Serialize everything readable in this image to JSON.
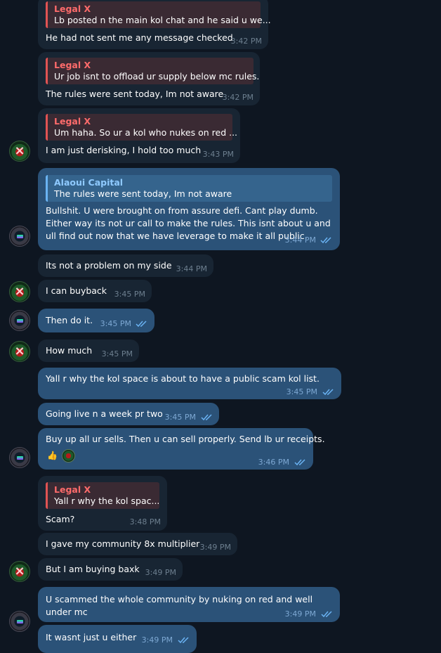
{
  "messages": {
    "m1": {
      "quote_name": "Legal X",
      "quote_text": "Lb posted n the main kol chat and he said u we...",
      "text": "He had not sent me any message checked",
      "time": "3:42 PM"
    },
    "m2": {
      "quote_name": "Legal X",
      "quote_text": "Ur job isnt to offload ur supply below mc rules.",
      "text": "The rules were sent today, Im not aware",
      "time": "3:42 PM"
    },
    "m3": {
      "quote_name": "Legal X",
      "quote_text": "Um haha. So ur a kol who nukes on red ...",
      "text": "I am just derisking, I hold too much",
      "time": "3:43 PM"
    },
    "m4": {
      "quote_name": "Alaoui Capital",
      "quote_text": "The rules were sent today, Im not aware",
      "text": "Bullshit. U were brought on from assure defi. Cant play dumb. Either way its not ur call to make the rules. This isnt about u and ull find out now that we have leverage to make it all public.",
      "time": "3:44 PM"
    },
    "m5": {
      "text": "Its not a problem on my side",
      "time": "3:44 PM"
    },
    "m6": {
      "text": "I can buyback",
      "time": "3:45 PM"
    },
    "m7": {
      "text": "Then do it.",
      "time": "3:45 PM"
    },
    "m8": {
      "text": "How much",
      "time": "3:45 PM"
    },
    "m9": {
      "text": "Yall r why the kol space is about to have a public scam kol list.",
      "time": "3:45 PM"
    },
    "m10": {
      "text": "Going live n a week pr two",
      "time": "3:45 PM"
    },
    "m11": {
      "text": "Buy up all ur sells. Then u can sell properly. Send lb ur receipts.",
      "time": "3:46 PM",
      "reactions": [
        "thumbs-up",
        "avatar"
      ]
    },
    "m12": {
      "quote_name": "Legal X",
      "quote_text": "Yall r why the kol spac...",
      "text": "Scam?",
      "time": "3:48 PM"
    },
    "m13": {
      "text": "I gave my community 8x multiplier",
      "time": "3:49 PM"
    },
    "m14": {
      "text": "But I am buying baxk",
      "time": "3:49 PM"
    },
    "m15": {
      "text": "U scammed the whole community by nuking on red and well under mc",
      "time": "3:49 PM"
    },
    "m16": {
      "text": "It wasnt just u either",
      "time": "3:49 PM"
    }
  },
  "colors": {
    "background": "#0e1621",
    "incoming_bubble": "#182533",
    "outgoing_bubble": "#2b5278",
    "reply_name_red": "#ff6b6b",
    "reply_name_blue": "#8fcaff"
  }
}
